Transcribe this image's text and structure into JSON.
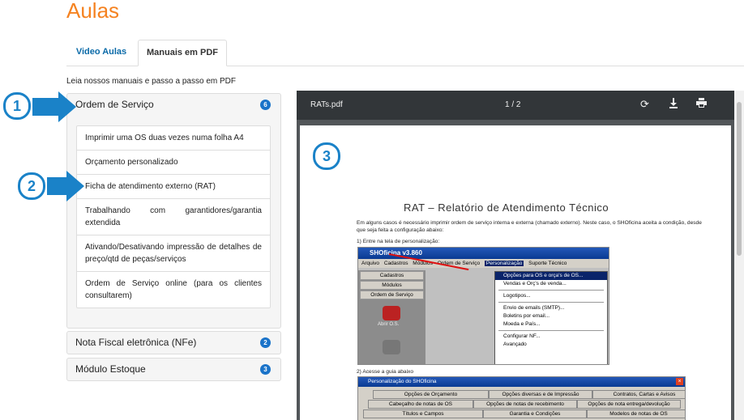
{
  "page": {
    "title": "Aulas",
    "intro": "Leia nossos manuais e passo a passo em PDF"
  },
  "tabs": [
    {
      "label": "Video Aulas"
    },
    {
      "label": "Manuais em PDF"
    }
  ],
  "accordion": [
    {
      "title": "Ordem de Serviço",
      "count": "6",
      "items": [
        "Imprimir uma OS duas vezes numa folha A4",
        "Orçamento personalizado",
        "Ficha de atendimento externo (RAT)",
        "Trabalhando com garantidores/garantia extendida",
        "Ativando/Desativando impressão de detalhes de preço/qtd de peças/serviços",
        "Ordem de Serviço online (para os clientes consultarem)"
      ]
    },
    {
      "title": "Nota Fiscal eletrônica (NFe)",
      "count": "2"
    },
    {
      "title": "Módulo Estoque",
      "count": "3"
    }
  ],
  "callouts": [
    "1",
    "2",
    "3"
  ],
  "viewer": {
    "filename": "RATs.pdf",
    "page_indicator": "1 / 2",
    "icons": [
      "rotate-icon",
      "download-icon",
      "print-icon"
    ],
    "doc": {
      "heading": "RAT – Relatório de Atendimento Técnico",
      "paragraph": "Em alguns casos é necessário imprimir ordem de serviço interna e externa (chamado externo). Neste caso, o SHOficina aceita a condição, desde que seja feita a configuração abaixo:",
      "step1": "1) Entre na tela de personalização:",
      "step2": "2) Acesse a guia abaixo",
      "app_title": "SHOficina v3.860",
      "menu": [
        "Arquivo",
        "Cadastros",
        "Módulos",
        "Ordem de Serviço",
        "Personalização",
        "Suporte Técnico"
      ],
      "side_buttons": [
        "Cadastros",
        "Módulos",
        "Ordem de Serviço"
      ],
      "side_label1": "Abrir O.S.",
      "dropdown": [
        "Opções para OS e orça's de OS...",
        "Vendas e Orç's de venda...",
        "Logotipos...",
        "Envio de emails (SMTP)...",
        "Boletins por email...",
        "Moeda e País...",
        "Configurar NF...",
        "Avançado"
      ],
      "dialog_title": "Personalização do SHOficina",
      "dialog_rows": [
        [
          "Opções de Orçamento",
          "Opções diversas e de Impressão",
          "Contratos, Cartas e Avisos"
        ],
        [
          "Cabeçalho de notas de OS",
          "Opções de notas de recebimento",
          "Opções de nota entrega/devolução"
        ],
        [
          "Títulos e Campos",
          "Garantia e Condições",
          "Modelos de notas de OS"
        ]
      ]
    }
  },
  "colors": {
    "accent": "#f58220",
    "link": "#0a6aa8",
    "badge": "#1a73c9",
    "callout": "#1a82c8"
  }
}
